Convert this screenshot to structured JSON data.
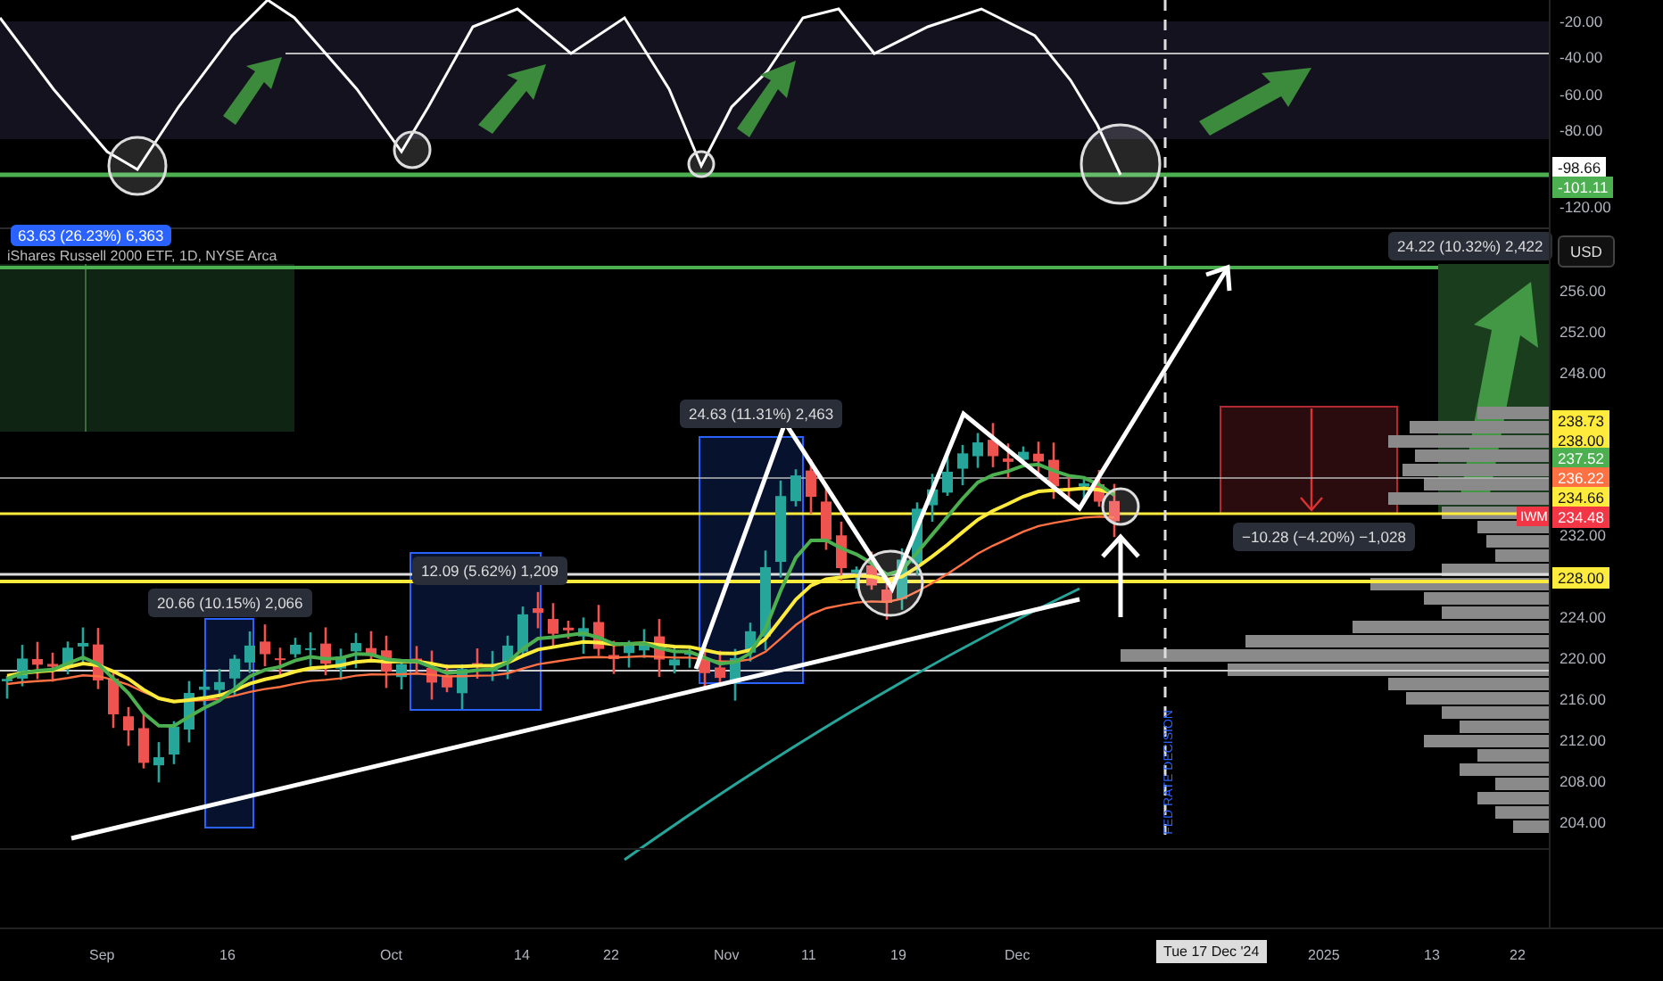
{
  "oscillator": {
    "axis_labels": [
      "-20.00",
      "-40.00",
      "-60.00",
      "-80.00",
      "-120.00"
    ],
    "value_tags": [
      {
        "text": "-98.66",
        "color": "#ffffff"
      },
      {
        "text": "-101.11",
        "color": "#4caf50"
      }
    ]
  },
  "main_chart": {
    "currency": "USD",
    "symbol_title": "iShares Russell 2000 ETF, 1D, NYSE Arca",
    "measurements": [
      {
        "text": "63.63 (26.23%) 6,363",
        "kind": "highlighted"
      },
      {
        "text": "24.63 (11.31%) 2,463",
        "kind": "plain"
      },
      {
        "text": "12.09 (5.62%) 1,209",
        "kind": "plain"
      },
      {
        "text": "20.66 (10.15%) 2,066",
        "kind": "plain"
      },
      {
        "text": "24.22 (10.32%) 2,422",
        "kind": "plain"
      },
      {
        "text": "−10.28 (−4.20%) −1,028",
        "kind": "plain"
      }
    ],
    "axis_labels": [
      "256.00",
      "252.00",
      "248.00",
      "232.00",
      "224.00",
      "220.00",
      "216.00",
      "212.00",
      "208.00",
      "204.00"
    ],
    "price_tags": [
      {
        "text": "238.73",
        "color": "#ffeb3b"
      },
      {
        "text": "238.00",
        "color": "#ffeb3b"
      },
      {
        "text": "237.52",
        "color": "#4caf50"
      },
      {
        "text": "236.22",
        "color": "#ff7043"
      },
      {
        "text": "234.66",
        "color": "#ffeb3b"
      },
      {
        "text": "234.48",
        "color": "#f23645"
      },
      {
        "text": "228.00",
        "color": "#ffeb3b"
      }
    ],
    "symbol_tag": "IWM",
    "event_label": "FED RATE DECISION"
  },
  "time_axis": [
    {
      "text": "Sep",
      "kind": "tick"
    },
    {
      "text": "16",
      "kind": "tick"
    },
    {
      "text": "Oct",
      "kind": "tick"
    },
    {
      "text": "14",
      "kind": "tick"
    },
    {
      "text": "22",
      "kind": "tick"
    },
    {
      "text": "Nov",
      "kind": "tick"
    },
    {
      "text": "11",
      "kind": "tick"
    },
    {
      "text": "19",
      "kind": "tick"
    },
    {
      "text": "Dec",
      "kind": "tick"
    },
    {
      "text": "Tue 17 Dec '24",
      "kind": "crosshair"
    },
    {
      "text": "2025",
      "kind": "tick"
    },
    {
      "text": "13",
      "kind": "tick"
    },
    {
      "text": "22",
      "kind": "tick"
    }
  ]
}
